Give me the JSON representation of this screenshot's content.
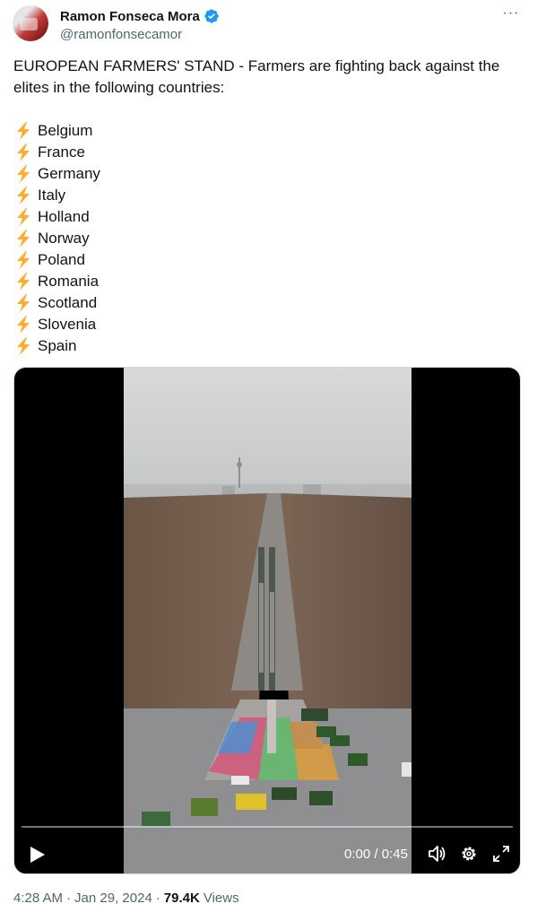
{
  "author": {
    "display_name": "Ramon Fonseca Mora",
    "handle": "@ramonfonsecamor",
    "verified": true,
    "avatar_icon": "profile-avatar"
  },
  "tweet": {
    "text": "EUROPEAN FARMERS' STAND - Farmers are fighting back against the elites in the following countries:",
    "bullet_icon": "lightning-bolt-emoji",
    "countries": [
      "Belgium",
      "France",
      "Germany",
      "Italy",
      "Holland",
      "Norway",
      "Poland",
      "Romania",
      "Scotland",
      "Slovenia",
      "Spain"
    ]
  },
  "video": {
    "current_time": "0:00",
    "duration": "0:45",
    "time_separator": " / ",
    "progress": 0,
    "controls": [
      "play-icon",
      "volume-icon",
      "gear-icon",
      "fullscreen-icon"
    ]
  },
  "meta": {
    "time": "4:28 AM",
    "date": "Jan 29, 2024",
    "views_count": "79.4K",
    "views_label": "Views",
    "separator": "·"
  },
  "colors": {
    "text_primary": "#0f1419",
    "text_secondary": "#536471",
    "verified_blue": "#1d9bf0",
    "bolt_yellow": "#ffac33"
  }
}
